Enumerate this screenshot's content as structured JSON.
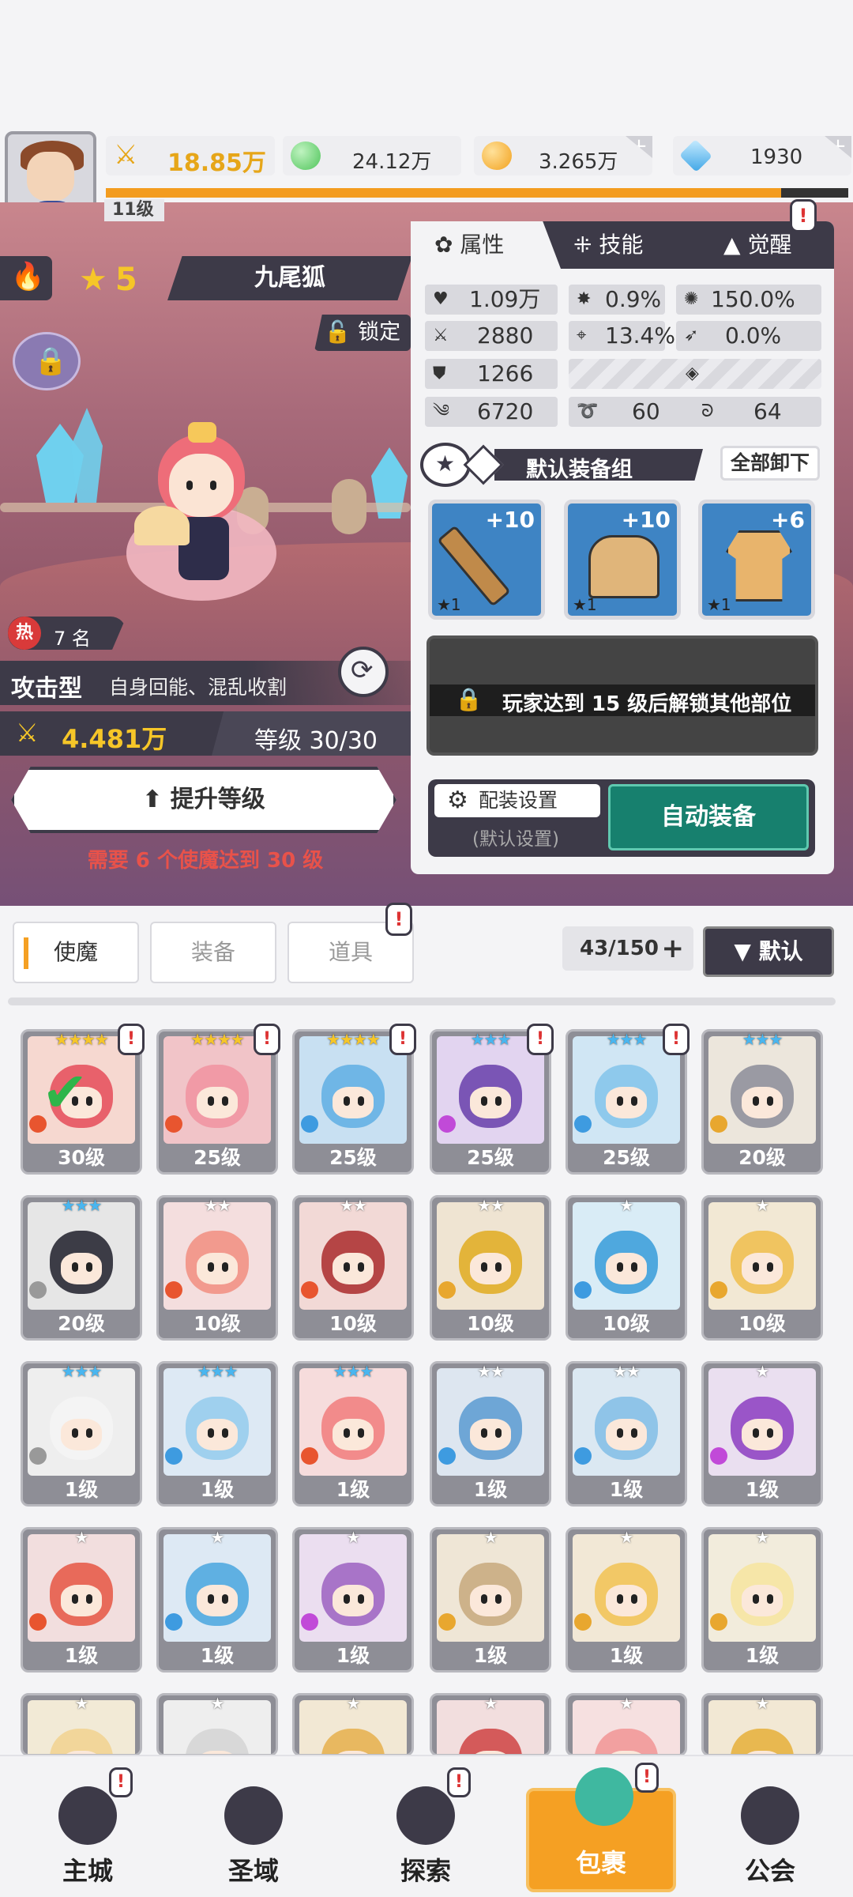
{
  "top": {
    "power": "18.85万",
    "jade": "24.12万",
    "gold": "3.265万",
    "diamond": "1930",
    "player_level": "11级",
    "xp_progress": 0.91
  },
  "hero": {
    "stars": "5",
    "name": "九尾狐",
    "lock_label": "锁定",
    "hot_rank": "7 名",
    "hot_badge": "热",
    "type": "攻击型",
    "skills_desc": "自身回能、混乱收割",
    "power": "4.481万",
    "level_text": "等级 30/30",
    "upgrade_label": "提升等级",
    "requirement": "需要 6 个使魔达到 30 级"
  },
  "panel": {
    "tabs": [
      "属性",
      "技能",
      "觉醒"
    ],
    "stats": {
      "hp": "1.09万",
      "crit": "0.9%",
      "crit_dmg": "150.0%",
      "atk": "2880",
      "hit": "13.4%",
      "dodge": "0.0%",
      "def": "1266",
      "speed": "6720",
      "stat_a": "60",
      "stat_b": "64"
    },
    "equip_set": "默认装备组",
    "unequip_all": "全部卸下",
    "equipment": [
      {
        "plus": "+10",
        "star": "★1",
        "kind": "sword"
      },
      {
        "plus": "+10",
        "star": "★1",
        "kind": "helmet"
      },
      {
        "plus": "+6",
        "star": "★1",
        "kind": "armor"
      }
    ],
    "locked_msg": "玩家达到 15 级后解锁其他部位",
    "loadout_settings": "配装设置",
    "loadout_default": "(默认设置)",
    "auto_equip": "自动装备"
  },
  "filters": {
    "tabs": [
      "使魔",
      "装备",
      "道具"
    ],
    "count": "43/150",
    "sort": "默认"
  },
  "cards": [
    {
      "level": "30级",
      "stars": "★★★★",
      "elem": "#e8552f",
      "alert": true,
      "bg": "#f6d8d0",
      "body": "#e8616b",
      "selected": true
    },
    {
      "level": "25级",
      "stars": "★★★★",
      "elem": "#e8552f",
      "alert": true,
      "bg": "#f1c4c8",
      "body": "#f19aa6"
    },
    {
      "level": "25级",
      "stars": "★★★★",
      "elem": "#3e9be0",
      "alert": true,
      "bg": "#c8e0f2",
      "body": "#6fb6e6"
    },
    {
      "level": "25级",
      "stars": "★★★",
      "elem": "#c14ad8",
      "alert": true,
      "bg": "#e2d4f0",
      "body": "#7a55b5"
    },
    {
      "level": "25级",
      "stars": "★★★",
      "elem": "#3e9be0",
      "alert": true,
      "bg": "#d0e6f4",
      "body": "#8ec9ec"
    },
    {
      "level": "20级",
      "stars": "★★★",
      "elem": "#e8a72f",
      "alert": false,
      "bg": "#ece6dc",
      "body": "#9a9aa3"
    },
    {
      "level": "20级",
      "stars": "★★★",
      "elem": "#999999",
      "alert": false,
      "bg": "#e6e6e6",
      "body": "#3c3c46"
    },
    {
      "level": "10级",
      "stars": "★★",
      "elem": "#e8552f",
      "alert": false,
      "bg": "#f4dede",
      "body": "#f29a8e"
    },
    {
      "level": "10级",
      "stars": "★★",
      "elem": "#e8552f",
      "alert": false,
      "bg": "#f2d9d6",
      "body": "#b54545"
    },
    {
      "level": "10级",
      "stars": "★★",
      "elem": "#e8a72f",
      "alert": false,
      "bg": "#efe4d2",
      "body": "#e3b43a"
    },
    {
      "level": "10级",
      "stars": "★",
      "elem": "#3e9be0",
      "alert": false,
      "bg": "#d9ecf6",
      "body": "#4fa8de"
    },
    {
      "level": "10级",
      "stars": "★",
      "elem": "#e8a72f",
      "alert": false,
      "bg": "#f2e8d4",
      "body": "#f0c460"
    },
    {
      "level": "1级",
      "stars": "★★★",
      "elem": "#999999",
      "alert": false,
      "bg": "#eeeeee",
      "body": "#f4f4f4"
    },
    {
      "level": "1级",
      "stars": "★★★",
      "elem": "#3e9be0",
      "alert": false,
      "bg": "#dde9f4",
      "body": "#9fd0ee"
    },
    {
      "level": "1级",
      "stars": "★★★",
      "elem": "#e8552f",
      "alert": false,
      "bg": "#f6dcdc",
      "body": "#f28b8b"
    },
    {
      "level": "1级",
      "stars": "★★",
      "elem": "#3e9be0",
      "alert": false,
      "bg": "#dde6f0",
      "body": "#6ea6d6"
    },
    {
      "level": "1级",
      "stars": "★★",
      "elem": "#3e9be0",
      "alert": false,
      "bg": "#dbe8f2",
      "body": "#8fc4e8"
    },
    {
      "level": "1级",
      "stars": "★",
      "elem": "#c14ad8",
      "alert": false,
      "bg": "#eadff0",
      "body": "#9a55c8"
    },
    {
      "level": "1级",
      "stars": "★",
      "elem": "#e8552f",
      "alert": false,
      "bg": "#f2dede",
      "body": "#e86a5a"
    },
    {
      "level": "1级",
      "stars": "★",
      "elem": "#3e9be0",
      "alert": false,
      "bg": "#dde9f4",
      "body": "#5fb0e2"
    },
    {
      "level": "1级",
      "stars": "★",
      "elem": "#c14ad8",
      "alert": false,
      "bg": "#ebdef0",
      "body": "#a874c8"
    },
    {
      "level": "1级",
      "stars": "★",
      "elem": "#e8a72f",
      "alert": false,
      "bg": "#efe6d6",
      "body": "#cdb28a"
    },
    {
      "level": "1级",
      "stars": "★",
      "elem": "#e8a72f",
      "alert": false,
      "bg": "#f2e8d6",
      "body": "#f2c866"
    },
    {
      "level": "1级",
      "stars": "★",
      "elem": "#e8a72f",
      "alert": false,
      "bg": "#f2ecdc",
      "body": "#f6e6a8"
    },
    {
      "level": "",
      "stars": "★",
      "elem": "",
      "alert": false,
      "bg": "#f2ead6",
      "body": "#f2d69a"
    },
    {
      "level": "",
      "stars": "★",
      "elem": "",
      "alert": false,
      "bg": "#eeeeee",
      "body": "#d8d8d8"
    },
    {
      "level": "",
      "stars": "★",
      "elem": "",
      "alert": false,
      "bg": "#f2e8d4",
      "body": "#e8b860"
    },
    {
      "level": "",
      "stars": "★",
      "elem": "",
      "alert": false,
      "bg": "#f2dede",
      "body": "#d45a5a"
    },
    {
      "level": "",
      "stars": "★",
      "elem": "",
      "alert": false,
      "bg": "#f6e0e0",
      "body": "#f2a0a0"
    },
    {
      "level": "",
      "stars": "★",
      "elem": "",
      "alert": false,
      "bg": "#f2e8d4",
      "body": "#e8b850"
    }
  ],
  "nav": [
    {
      "label": "主城",
      "icon": "castle-icon",
      "alert": true
    },
    {
      "label": "圣域",
      "icon": "vortex-icon",
      "alert": false
    },
    {
      "label": "探索",
      "icon": "sword-stone-icon",
      "alert": true
    },
    {
      "label": "包裹",
      "icon": "bag-icon",
      "alert": true,
      "active": true
    },
    {
      "label": "公会",
      "icon": "guild-icon",
      "alert": false
    }
  ],
  "colors": {
    "accent": "#f5a023",
    "dark": "#3d3a48",
    "teal": "#17806e",
    "red": "#e8524a"
  }
}
